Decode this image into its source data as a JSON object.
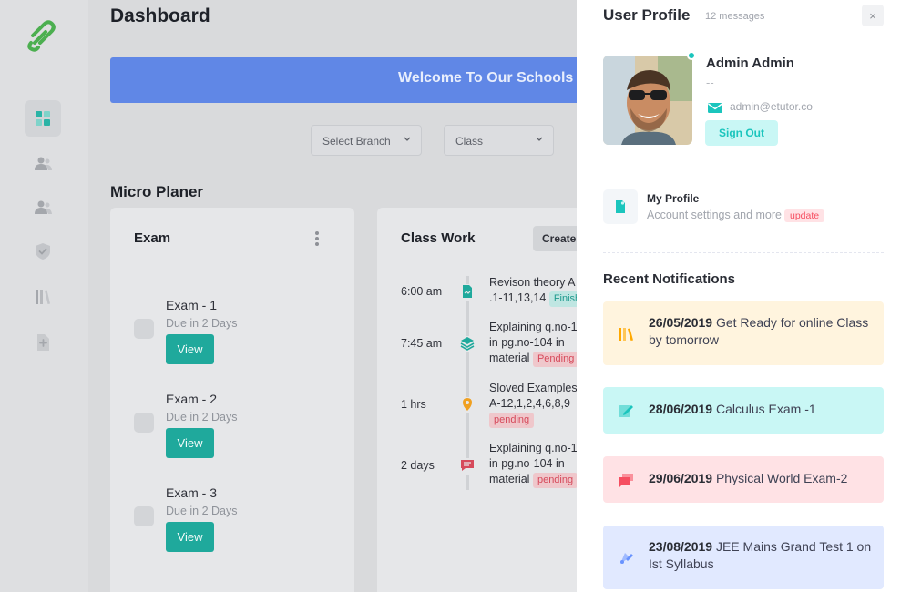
{
  "sidebar": {
    "items": [
      {
        "icon": "dashboard-icon",
        "active": true
      },
      {
        "icon": "users-icon"
      },
      {
        "icon": "group-icon"
      },
      {
        "icon": "shield-check-icon"
      },
      {
        "icon": "library-icon"
      },
      {
        "icon": "file-add-icon"
      }
    ]
  },
  "header": {
    "title": "Dashboard"
  },
  "banner": {
    "text": "Welcome To Our Schools"
  },
  "filters": {
    "branch": "Select Branch",
    "class": "Class"
  },
  "micro_planer": {
    "title": "Micro Planer",
    "exam_card": {
      "title": "Exam",
      "items": [
        {
          "name": "Exam - 1",
          "due": "Due in 2 Days",
          "button": "View"
        },
        {
          "name": "Exam - 2",
          "due": "Due in 2 Days",
          "button": "View"
        },
        {
          "name": "Exam - 3",
          "due": "Due in 2 Days",
          "button": "View"
        }
      ]
    },
    "classwork_card": {
      "title": "Class Work",
      "create_label": "Create",
      "timeline": [
        {
          "time": "6:00 am",
          "icon": "file-icon",
          "line1": "Revison theory A",
          "line2": ".1-11,13,14",
          "badge": "Finished",
          "badge_type": "finished"
        },
        {
          "time": "7:45 am",
          "icon": "layers-icon",
          "line1": "Explaining q.no-1",
          "line2": "in pg.no-104 in",
          "line3": "material",
          "badge": "Pending",
          "badge_type": "pending"
        },
        {
          "time": "1 hrs",
          "icon": "location-icon",
          "line1": "Sloved Examples",
          "line2": "A-12,1,2,4,6,8,9",
          "badge": "pending",
          "badge_type": "pending"
        },
        {
          "time": "2 days",
          "icon": "chat-icon",
          "line1": "Explaining q.no-1",
          "line2": "in pg.no-104 in",
          "line3": "material",
          "badge": "pending",
          "badge_type": "pending"
        }
      ]
    }
  },
  "user_profile": {
    "title": "User Profile",
    "messages": "12 messages",
    "close": "×",
    "name": "Admin Admin",
    "role": "--",
    "email": "admin@etutor.co",
    "signout": "Sign Out",
    "my_profile": {
      "title": "My Profile",
      "subtitle": "Account settings and more",
      "badge": "update"
    },
    "recent_title": "Recent Notifications",
    "notifications": [
      {
        "date": "26/05/2019",
        "text": "Get Ready for online Class by tomorrow",
        "icon": "library-icon",
        "bg": "#fff4de",
        "color": "#ffa800"
      },
      {
        "date": "28/06/2019",
        "text": "Calculus Exam -1",
        "icon": "edit-icon",
        "bg": "#c9f7f5",
        "color": "#1bc5bd"
      },
      {
        "date": "29/06/2019",
        "text": "Physical World Exam-2",
        "icon": "chat-icon",
        "bg": "#ffe2e5",
        "color": "#f64e60"
      },
      {
        "date": "23/08/2019",
        "text": "JEE Mains Grand Test 1 on Ist Syllabus",
        "icon": "pen-tool-icon",
        "bg": "#e1e9ff",
        "color": "#6993ff"
      }
    ]
  },
  "colors": {
    "teal": "#1fa99c",
    "banner": "#6087e6",
    "pending": "#d64a5b"
  }
}
